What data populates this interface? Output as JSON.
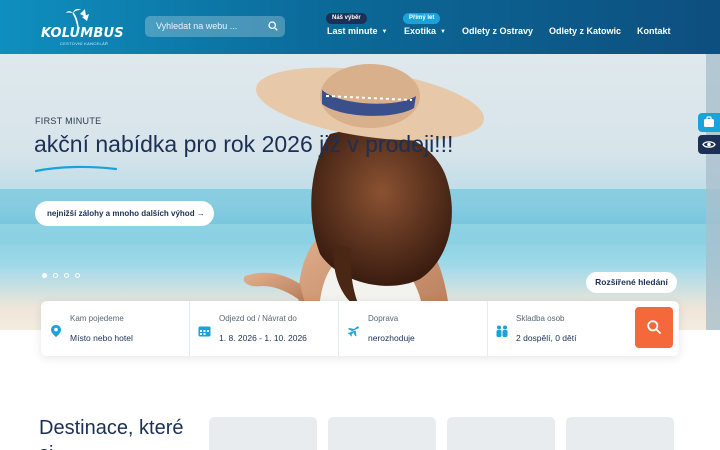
{
  "header": {
    "logo_text": "KOLUMBUS",
    "logo_subtitle": "CESTOVNÍ KANCELÁŘ",
    "search_placeholder": "Vyhledat na webu ..."
  },
  "nav": {
    "items": [
      {
        "label": "Last minute",
        "has_dropdown": true,
        "badge": "Náš výběr",
        "badge_color": "#1c2f55"
      },
      {
        "label": "Exotika",
        "has_dropdown": true,
        "badge": "Přímý let",
        "badge_color": "#1aa3d9"
      },
      {
        "label": "Odlety z Ostravy"
      },
      {
        "label": "Odlety z Katowic"
      },
      {
        "label": "Kontakt"
      }
    ]
  },
  "hero": {
    "kicker": "FIRST MINUTE",
    "title": "akční nabídka pro rok 2026 již v prodeji!!!",
    "cta": "nejnižší zálohy a mnoho dalších výhod →",
    "slides_total": 4,
    "slide_active": 1,
    "advanced_search": "Rozšířené hledání"
  },
  "side_buttons": [
    {
      "icon": "suitcase-icon",
      "color": "#1aa3d9"
    },
    {
      "icon": "eye-icon",
      "color": "#1c2f55"
    }
  ],
  "searchbar": {
    "fields": [
      {
        "label": "Kam pojedeme",
        "value": "Místo nebo hotel",
        "icon": "map-pin-icon"
      },
      {
        "label": "Odjezd od / Návrat do",
        "value": "1. 8. 2026 - 1. 10. 2026",
        "icon": "calendar-icon"
      },
      {
        "label": "Doprava",
        "value": "nerozhoduje",
        "icon": "plane-icon"
      },
      {
        "label": "Skladba osob",
        "value": "2 dospělí, 0 dětí",
        "icon": "people-icon"
      }
    ],
    "button_icon": "search-icon"
  },
  "destinations": {
    "title": "Destinace, které si"
  },
  "colors": {
    "accent": "#1aa3d9",
    "navy": "#1c2f55",
    "cta_orange": "#f4683c"
  }
}
